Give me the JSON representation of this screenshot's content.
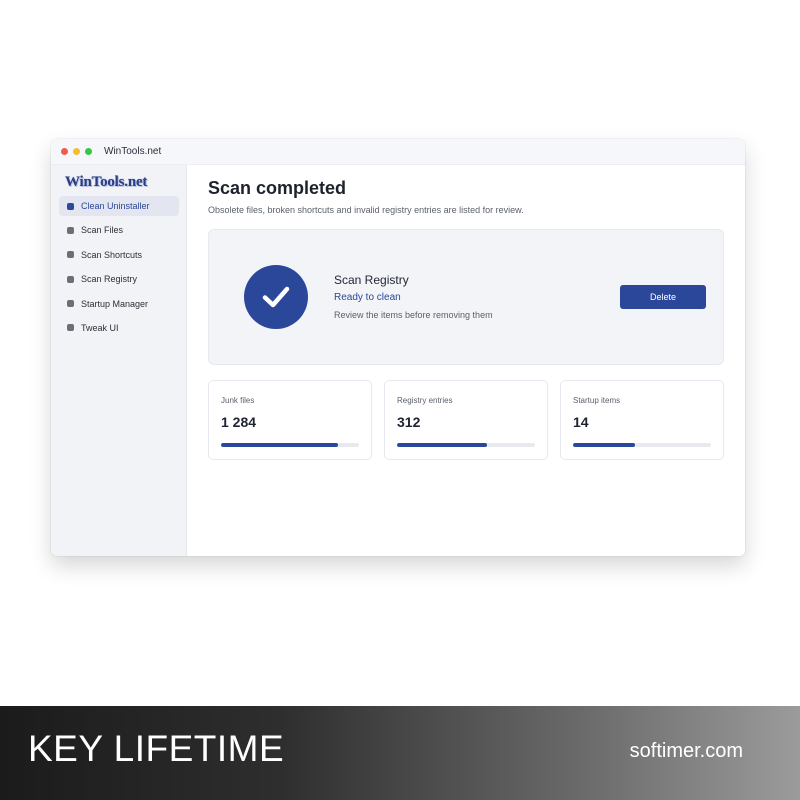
{
  "window": {
    "title": "WinTools.net"
  },
  "sidebar": {
    "logo": "WinTools.net",
    "items": [
      {
        "label": "Clean Uninstaller",
        "active": true
      },
      {
        "label": "Scan Files",
        "active": false
      },
      {
        "label": "Scan Shortcuts",
        "active": false
      },
      {
        "label": "Scan Registry",
        "active": false
      },
      {
        "label": "Startup Manager",
        "active": false
      },
      {
        "label": "Tweak UI",
        "active": false
      }
    ]
  },
  "main": {
    "title": "Scan completed",
    "subtitle": "Obsolete files, broken shortcuts and invalid registry entries are listed for review.",
    "scan_card": {
      "icon": "checkmark-icon",
      "name": "Scan Registry",
      "status": "Ready to clean",
      "hint": "Review the items before removing them",
      "delete_label": "Delete"
    },
    "stats": [
      {
        "label": "Junk files",
        "value": "1 284",
        "progress": 0.85
      },
      {
        "label": "Registry entries",
        "value": "312",
        "progress": 0.65
      },
      {
        "label": "Startup items",
        "value": "14",
        "progress": 0.45
      }
    ]
  },
  "footer": {
    "left_text": "KEY LIFETIME",
    "right_text": "softimer.com"
  },
  "colors": {
    "accent": "#2b479a",
    "sidebar_bg": "#f2f3f7",
    "card_bg": "#f2f4f8",
    "track": "#e8eaf0",
    "traffic_red": "#ef5b4f",
    "traffic_yellow": "#f5bd2d",
    "traffic_green": "#35c742"
  }
}
